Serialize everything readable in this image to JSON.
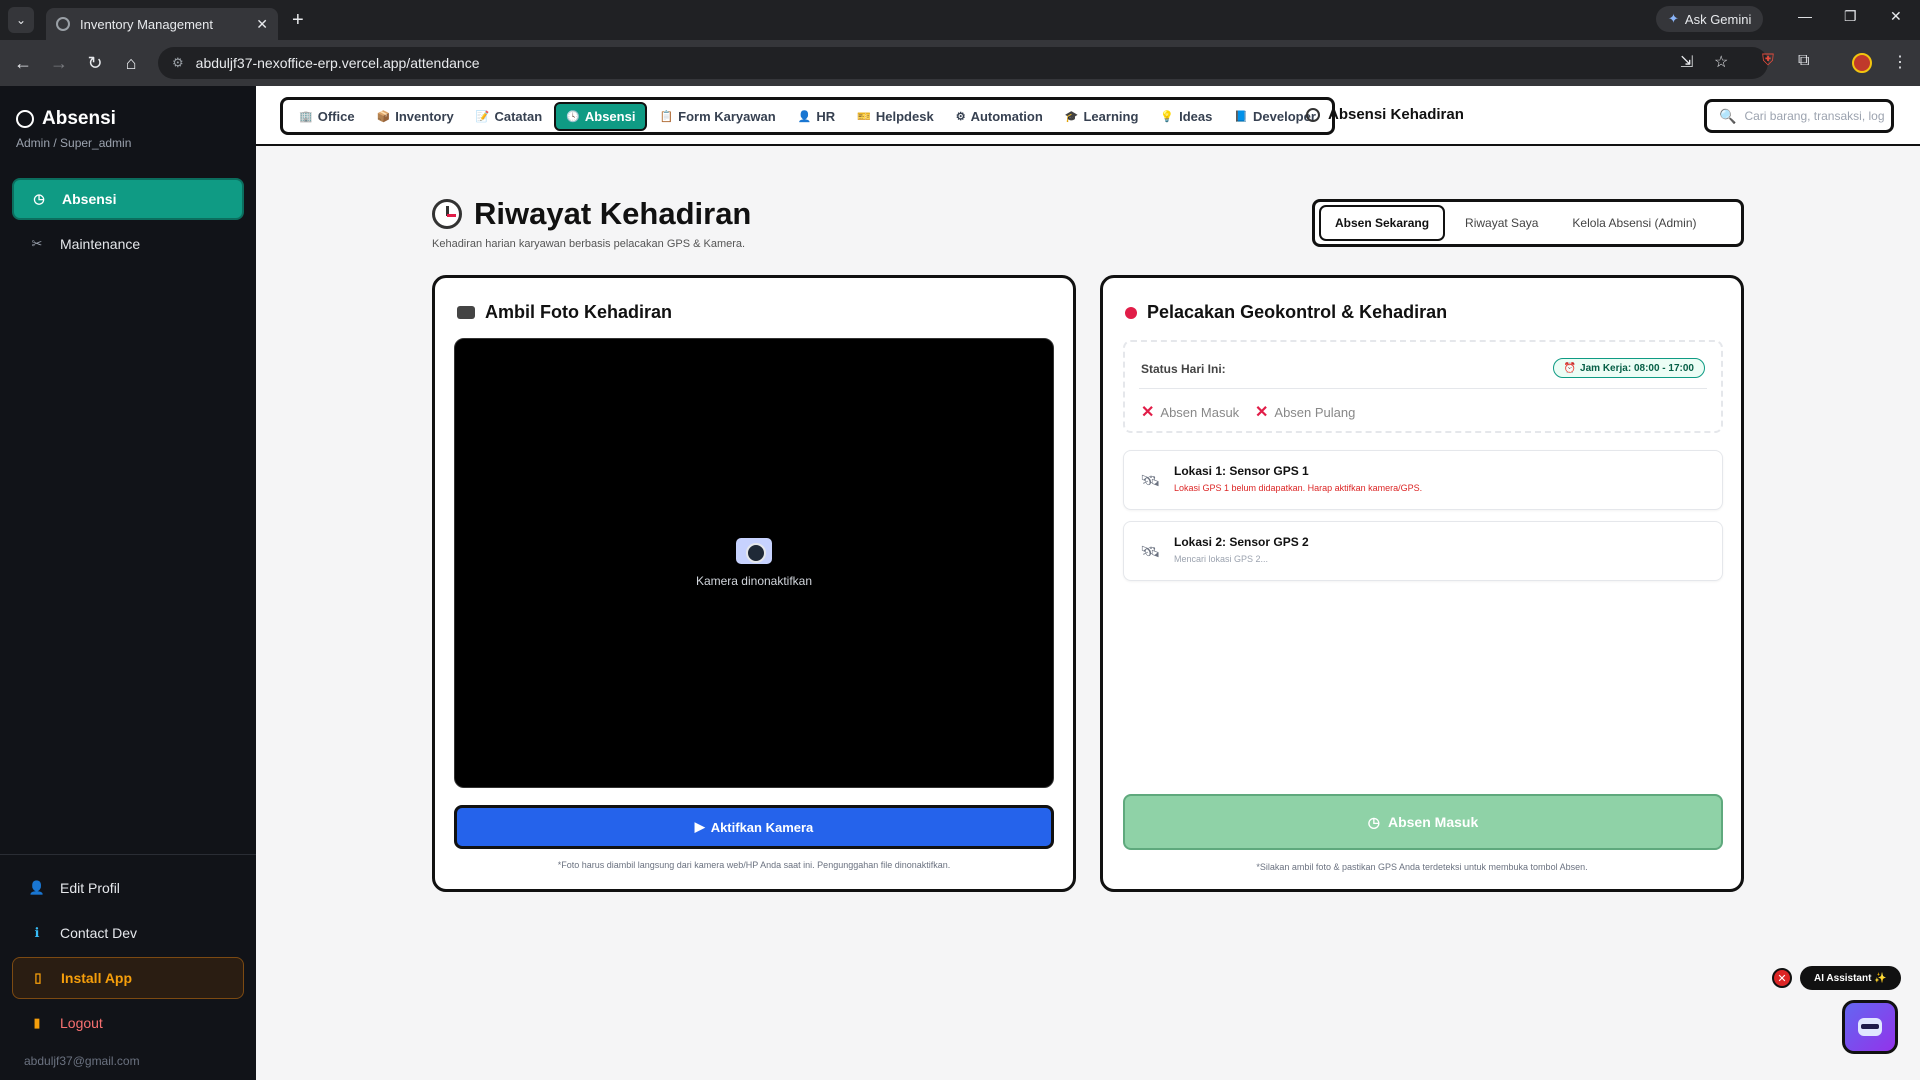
{
  "browser": {
    "tab_title": "Inventory Management",
    "url": "abduljf37-nexoffice-erp.vercel.app/attendance",
    "gemini_label": "Ask Gemini"
  },
  "sidebar": {
    "title": "Absensi",
    "role": "Admin / Super_admin",
    "items": [
      {
        "label": "Absensi",
        "icon": "clock-icon",
        "active": true
      },
      {
        "label": "Maintenance",
        "icon": "tools-icon"
      }
    ],
    "bottom": [
      {
        "label": "Edit Profil",
        "icon": "user-icon"
      },
      {
        "label": "Contact Dev",
        "icon": "info-icon"
      },
      {
        "label": "Install App",
        "icon": "phone-icon"
      },
      {
        "label": "Logout",
        "icon": "door-icon"
      }
    ],
    "email": "abduljf37@gmail.com"
  },
  "nav": {
    "items": [
      {
        "label": "Office",
        "icon": "🏢"
      },
      {
        "label": "Inventory",
        "icon": "📦"
      },
      {
        "label": "Catatan",
        "icon": "📝"
      },
      {
        "label": "Absensi",
        "icon": "🕓",
        "active": true
      },
      {
        "label": "Form Karyawan",
        "icon": "📋"
      },
      {
        "label": "HR",
        "icon": "👤"
      },
      {
        "label": "Helpdesk",
        "icon": "🎫"
      },
      {
        "label": "Automation",
        "icon": "⚙"
      },
      {
        "label": "Learning",
        "icon": "🎓"
      },
      {
        "label": "Ideas",
        "icon": "💡"
      },
      {
        "label": "Developer",
        "icon": "📘"
      }
    ],
    "page_title": "Absensi Kehadiran",
    "search_placeholder": "Cari barang, transaksi, log"
  },
  "main": {
    "title": "Riwayat Kehadiran",
    "subtitle": "Kehadiran harian karyawan berbasis pelacakan GPS & Kamera.",
    "tabs": [
      "Absen Sekarang",
      "Riwayat Saya",
      "Kelola Absensi (Admin)"
    ],
    "camera_card": {
      "title": "Ambil Foto Kehadiran",
      "placeholder": "Kamera dinonaktifkan",
      "button": "Aktifkan Kamera",
      "note": "*Foto harus diambil langsung dari kamera web/HP Anda saat ini. Pengunggahan file dinonaktifkan."
    },
    "geo_card": {
      "title": "Pelacakan Geokontrol & Kehadiran",
      "status_label": "Status Hari Ini:",
      "work_hours": "Jam Kerja: 08:00 - 17:00",
      "checkin": "Absen Masuk",
      "checkout": "Absen Pulang",
      "locations": [
        {
          "title": "Lokasi 1: Sensor GPS 1",
          "desc": "Lokasi GPS 1 belum didapatkan. Harap aktifkan kamera/GPS.",
          "color": "#dc2626"
        },
        {
          "title": "Lokasi 2: Sensor GPS 2",
          "desc": "Mencari lokasi GPS 2...",
          "color": "#9ca3af"
        }
      ],
      "button": "Absen Masuk",
      "note": "*Silakan ambil foto & pastikan GPS Anda terdeteksi untuk membuka tombol Absen."
    }
  },
  "assistant": {
    "label": "AI Assistant ✨"
  },
  "colors": {
    "accent": "#0f9b84",
    "primary": "#2563eb",
    "disabled_green": "#8fd2a7"
  }
}
